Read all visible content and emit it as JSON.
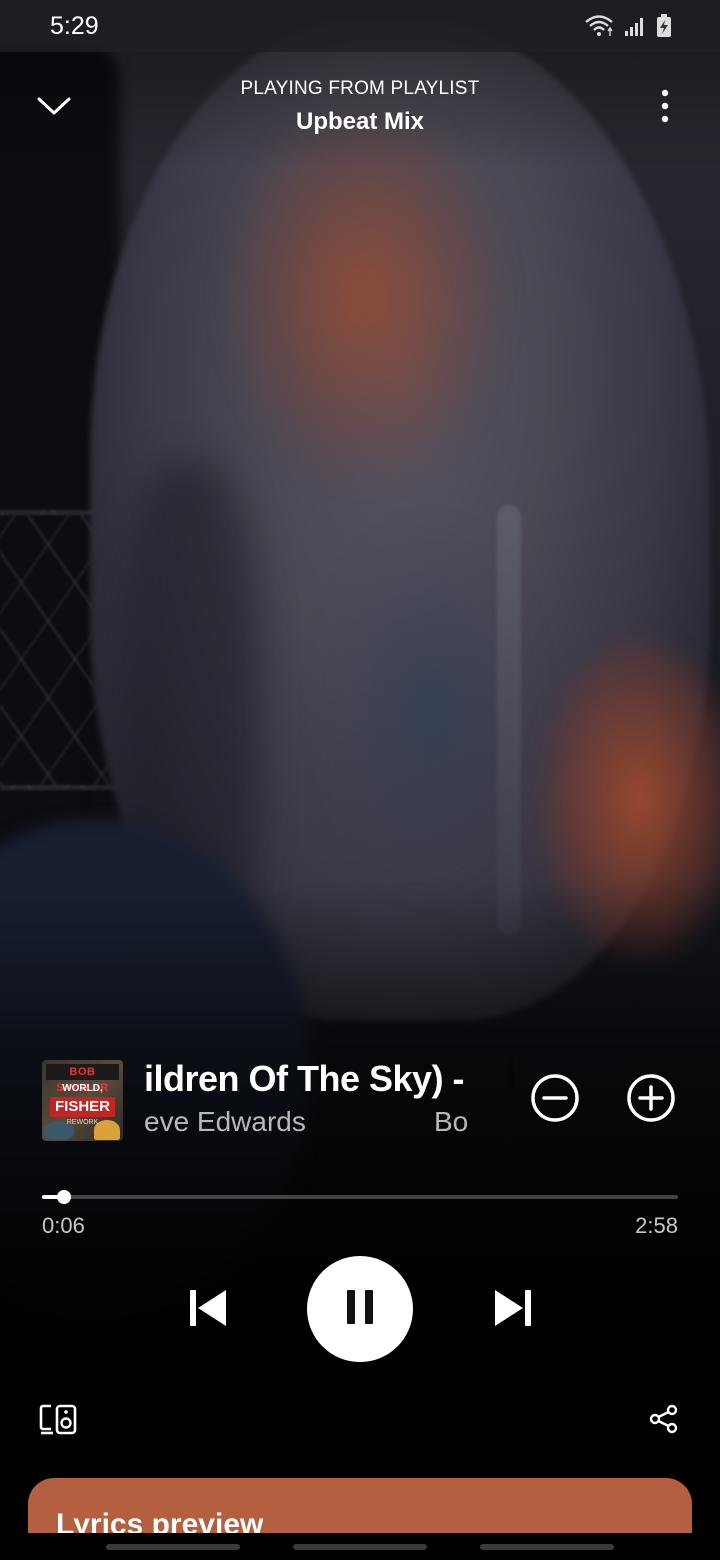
{
  "status_bar": {
    "time": "5:29"
  },
  "header": {
    "caption": "PLAYING FROM PLAYLIST",
    "playlist_name": "Upbeat Mix"
  },
  "track": {
    "title_visible": "ildren Of The Sky) -",
    "artist_visible": "eve Edwards",
    "artist_tail_visible": "Bo",
    "cover_art_text": {
      "line1": "BOB SINCLAR",
      "line2": "WORLD, HOLD ON",
      "line3": "FISHER",
      "line4": "REWORK"
    }
  },
  "progress": {
    "current_time": "0:06",
    "total_time": "2:58",
    "fraction": 0.034
  },
  "lyrics": {
    "title": "Lyrics preview",
    "card_color": "#b45f40"
  },
  "icons": {
    "collapse": "chevron-down-icon",
    "more": "more-vertical-icon",
    "remove": "minus-circle-icon",
    "add": "plus-circle-icon",
    "previous": "skip-previous-icon",
    "pause": "pause-icon",
    "next": "skip-next-icon",
    "devices": "connect-devices-icon",
    "share": "share-icon"
  }
}
